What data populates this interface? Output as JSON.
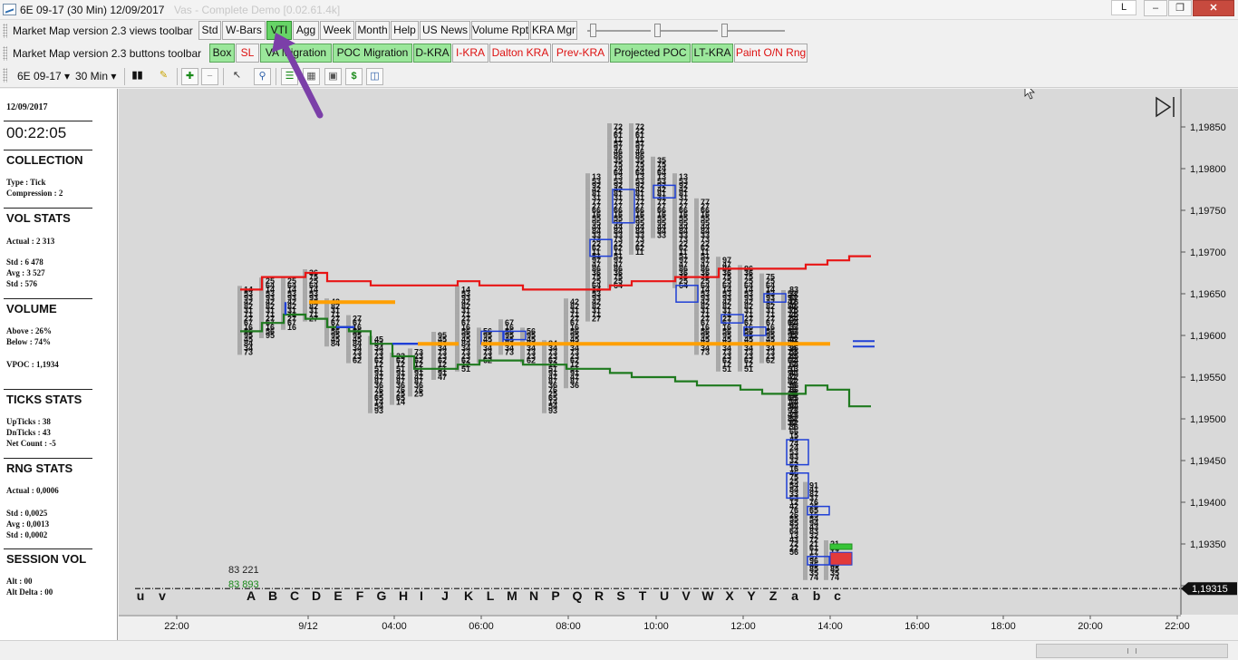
{
  "window": {
    "title": "6E 09-17 (30 Min)   12/09/2017",
    "title_faded": "Vas - Complete Demo [0.02.61.4k]",
    "lang_indicator": "L",
    "minimize_glyph": "‒",
    "maximize_glyph": "❐",
    "close_glyph": "✕"
  },
  "views_toolbar": {
    "label": "Market Map version 2.3  views toolbar",
    "buttons": [
      "Std",
      "W-Bars",
      "VTI",
      "Agg",
      "Week",
      "Month",
      "Help",
      "US News",
      "Volume Rpt",
      "KRA Mgr"
    ],
    "active": "VTI"
  },
  "buttons_toolbar": {
    "label": "Market Map version 2.3  buttons toolbar",
    "buttons": [
      "Box",
      "SL",
      "VA Migration",
      "POC Migration",
      "D-KRA",
      "I-KRA",
      "Dalton KRA",
      "Prev-KRA",
      "Projected POC",
      "LT-KRA",
      "Paint O/N Rng"
    ]
  },
  "chart_toolbar": {
    "instrument": "6E 09-17",
    "interval": "30 Min"
  },
  "stats": {
    "date": "12/09/2017",
    "clock": "00:22:05",
    "collection_head": "COLLECTION",
    "type": "Type : Tick",
    "compression": "Compression : 2",
    "vol_head": "VOL STATS",
    "actual": "Actual : 2 313",
    "std": "Std : 6 478",
    "avg": "Avg : 3 527",
    "std2": "Std : 576",
    "volume_head": "VOLUME",
    "above": "Above : 26%",
    "below": "Below : 74%",
    "vpoc": "VPOC : 1,1934",
    "ticks_head": "TICKS STATS",
    "upticks": "UpTicks : 38",
    "dnticks": "DnTicks : 43",
    "netcount": "Net Count : -5",
    "rng_head": "RNG STATS",
    "rng_actual": "Actual : 0,0006",
    "rng_std": "Std : 0,0025",
    "rng_avg": "Avg : 0,0013",
    "rng_std2": "Std : 0,0002",
    "session_head": "SESSION VOL",
    "alt": "Alt : 00",
    "alt_delta": "Alt Delta : 00"
  },
  "chart_data": {
    "type": "line",
    "price_axis": {
      "ticks": [
        "1,19850",
        "1,19800",
        "1,19750",
        "1,19700",
        "1,19650",
        "1,19600",
        "1,19550",
        "1,19500",
        "1,19450",
        "1,19400",
        "1,19350",
        "1,19300"
      ],
      "ylim": [
        1.193,
        1.1985
      ],
      "current_price": "1,19315"
    },
    "time_axis": {
      "ticks": [
        "22:00",
        "9/12",
        "04:00",
        "06:00",
        "08:00",
        "10:00",
        "12:00",
        "14:00",
        "16:00",
        "18:00",
        "20:00",
        "22:00"
      ]
    },
    "period_letters": [
      "u",
      "v",
      "A",
      "B",
      "C",
      "D",
      "E",
      "F",
      "G",
      "H",
      "I",
      "J",
      "K",
      "L",
      "M",
      "N",
      "P",
      "Q",
      "R",
      "S",
      "T",
      "U",
      "V",
      "W",
      "X",
      "Y",
      "Z",
      "a",
      "b",
      "c"
    ],
    "volume_labels": [
      "83 221",
      "83 893"
    ],
    "levels": {
      "va_high": [
        1.19655,
        1.1967,
        1.1967,
        1.19675,
        1.19665,
        1.19665,
        1.1966,
        1.1966,
        1.1966,
        1.1966,
        1.19665,
        1.1966,
        1.1966,
        1.19655,
        1.19655,
        1.19655,
        1.19655,
        1.1966,
        1.19665,
        1.19665,
        1.1967,
        1.1967,
        1.1968,
        1.1968,
        1.1968,
        1.1968,
        1.19685,
        1.1969,
        1.19695
      ],
      "va_low": [
        1.19605,
        1.19615,
        1.19625,
        1.1962,
        1.1961,
        1.19605,
        1.1959,
        1.19575,
        1.1956,
        1.1956,
        1.19565,
        1.1957,
        1.1957,
        1.19565,
        1.19565,
        1.1956,
        1.1956,
        1.19555,
        1.1955,
        1.1955,
        1.19545,
        1.1954,
        1.1954,
        1.19535,
        1.1953,
        1.1953,
        1.1954,
        1.19535,
        1.19515
      ],
      "poc_prior": 1.1964,
      "poc_current": 1.1959,
      "projected_poc": 1.1959
    }
  }
}
